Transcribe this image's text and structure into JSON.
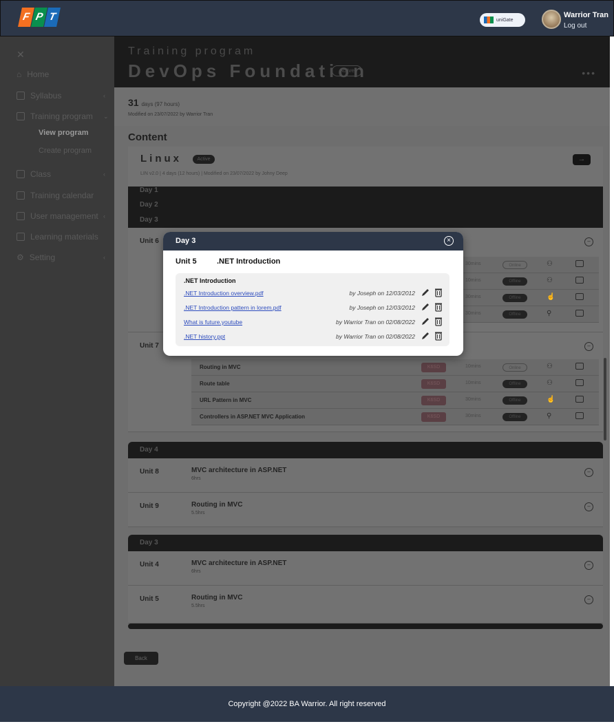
{
  "header": {
    "logo_letters": [
      "F",
      "P",
      "T"
    ],
    "unigate_label": "uniGate",
    "user_name": "Warrior Tran",
    "logout_label": "Log out"
  },
  "sidebar": {
    "items": [
      {
        "label": "Home",
        "icon": "home-icon"
      },
      {
        "label": "Syllabus",
        "icon": "book-icon"
      },
      {
        "label": "Training program",
        "icon": "training-icon"
      },
      {
        "label": "Class",
        "icon": "class-icon"
      },
      {
        "label": "Training calendar",
        "icon": "calendar-icon"
      },
      {
        "label": "User management",
        "icon": "users-icon"
      },
      {
        "label": "Learning materials",
        "icon": "folder-icon"
      },
      {
        "label": "Setting",
        "icon": "gear-icon"
      }
    ],
    "sub_items": [
      "View program",
      "Create program"
    ]
  },
  "program": {
    "subtitle": "Training program",
    "title": "DevOps Foundation",
    "status": "Active",
    "more": "•••",
    "days": "31",
    "days_suffix": "days (97 hours)",
    "modified": "Modified on 23/07/2022 by Warrior Tran"
  },
  "content_heading": "Content",
  "syllabus": {
    "name": "Linux",
    "status": "Active",
    "meta": "LIN v2.0  |  4 days (12 hours)  |  Modified on 23/07/2022 by Johny Deep"
  },
  "days_top": [
    "Day 1",
    "Day 2",
    "Day 3"
  ],
  "units_top": [
    {
      "label": "Unit 6"
    },
    {
      "label": "Unit 7"
    }
  ],
  "unit7_lessons": [
    {
      "name": "Routing in MVC",
      "code": "K6SD",
      "duration": "10mins",
      "status": "Online",
      "outline": true
    },
    {
      "name": "Route table",
      "code": "K6SD",
      "duration": "10mins",
      "status": "Offline",
      "outline": false
    },
    {
      "name": "URL Pattern in MVC",
      "code": "K6SD",
      "duration": "30mins",
      "status": "Offline",
      "outline": false
    },
    {
      "name": "Controllers in ASP.NET MVC Application",
      "code": "K6SD",
      "duration": "30mins",
      "status": "Offline",
      "outline": false
    }
  ],
  "unit6_lessons": [
    {
      "duration": "30mins",
      "status": "Online",
      "outline": true
    },
    {
      "duration": "10mins",
      "status": "Offline",
      "outline": false
    },
    {
      "duration": "30mins",
      "status": "Offline",
      "outline": false
    },
    {
      "duration": "30mins",
      "status": "Offline",
      "outline": false
    }
  ],
  "day4": {
    "label": "Day 4",
    "units": [
      {
        "label": "Unit 8",
        "name": "MVC architecture in ASP.NET",
        "duration": "6hrs"
      },
      {
        "label": "Unit 9",
        "name": "Routing in MVC",
        "duration": "5.5hrs"
      }
    ]
  },
  "day3b": {
    "label": "Day 3",
    "units": [
      {
        "label": "Unit 4",
        "name": "MVC architecture in ASP.NET",
        "duration": "6hrs"
      },
      {
        "label": "Unit 5",
        "name": "Routing in MVC",
        "duration": "5.5hrs"
      }
    ]
  },
  "back_label": "Back",
  "footer": {
    "copyright": "Copyright @2022 BA Warrior. All right reserved"
  },
  "modal": {
    "title": "Day 3",
    "unit": "Unit 5",
    "unit_title": ".NET Introduction",
    "materials_heading": ".NET Introduction",
    "materials": [
      {
        "name": ".NET Introduction overview.pdf",
        "by": "by Joseph on 12/03/2012"
      },
      {
        "name": ".NET Introduction pattern in lorem.pdf",
        "by": "by Joseph on 12/03/2012"
      },
      {
        "name": "What is future.youtube",
        "by": "by Warrior Tran on 02/08/2022"
      },
      {
        "name": ".NET history.ppt",
        "by": "by Warrior Tran on 02/08/2022"
      }
    ]
  },
  "colors": {
    "header_bg": "#2d3748",
    "link": "#2c4bbd",
    "accent_orange": "#f37021",
    "accent_green": "#0a8f4e",
    "accent_blue": "#1b6bb8"
  }
}
